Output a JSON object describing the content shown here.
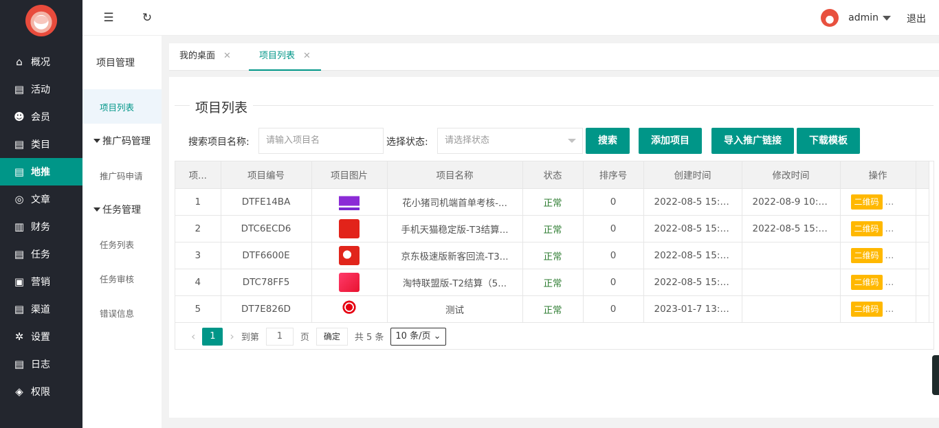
{
  "sidebar": {
    "items": [
      {
        "label": "概况",
        "icon": "home-icon"
      },
      {
        "label": "活动",
        "icon": "doc-icon"
      },
      {
        "label": "会员",
        "icon": "users-icon"
      },
      {
        "label": "类目",
        "icon": "doc-icon"
      },
      {
        "label": "地推",
        "icon": "doc-icon",
        "active": true
      },
      {
        "label": "文章",
        "icon": "compass-icon"
      },
      {
        "label": "财务",
        "icon": "chart-icon"
      },
      {
        "label": "任务",
        "icon": "doc-icon"
      },
      {
        "label": "营销",
        "icon": "gift-icon"
      },
      {
        "label": "渠道",
        "icon": "doc-icon"
      },
      {
        "label": "设置",
        "icon": "gear-icon"
      },
      {
        "label": "日志",
        "icon": "doc-icon"
      },
      {
        "label": "权限",
        "icon": "lock-icon"
      }
    ]
  },
  "subnav": {
    "head": "项目管理",
    "item_project_list": "项目列表",
    "group_promo": "推广码管理",
    "item_promo_apply": "推广码申请",
    "group_task": "任务管理",
    "item_task_list": "任务列表",
    "item_task_review": "任务审核",
    "item_errors": "错误信息"
  },
  "header": {
    "user": "admin",
    "logout": "退出"
  },
  "tabs": [
    {
      "label": "我的桌面"
    },
    {
      "label": "项目列表",
      "active": true
    }
  ],
  "page": {
    "title": "项目列表",
    "search_label": "搜索项目名称:",
    "search_placeholder": "请输入项目名",
    "status_label": "选择状态:",
    "status_placeholder": "请选择状态",
    "btn_search": "搜索",
    "btn_add": "添加项目",
    "btn_import": "导入推广链接",
    "btn_download": "下载模板"
  },
  "table": {
    "headers": [
      "项...",
      "项目编号",
      "项目图片",
      "项目名称",
      "状态",
      "排序号",
      "创建时间",
      "修改时间",
      "操作"
    ],
    "rows": [
      {
        "id": "1",
        "code": "DTFE14BA",
        "name": "花小猪司机端首单考核-...",
        "status": "正常",
        "sort": "0",
        "created": "2022-08-5 15:1...",
        "modified": "2022-08-9 10:5...",
        "op": "二维码",
        "more": "...",
        "img": "purple"
      },
      {
        "id": "2",
        "code": "DTC6ECD6",
        "name": "手机天猫稳定版-T3结算...",
        "status": "正常",
        "sort": "0",
        "created": "2022-08-5 15:1...",
        "modified": "2022-08-5 15:1...",
        "op": "二维码",
        "more": "...",
        "img": "tmall"
      },
      {
        "id": "3",
        "code": "DTF6600E",
        "name": "京东极速版新客回流-T3...",
        "status": "正常",
        "sort": "0",
        "created": "2022-08-5 15:1...",
        "modified": "",
        "op": "二维码",
        "more": "...",
        "img": "jd"
      },
      {
        "id": "4",
        "code": "DTC78FF5",
        "name": "淘特联盟版-T2结算（5...",
        "status": "正常",
        "sort": "0",
        "created": "2022-08-5 15:3...",
        "modified": "",
        "op": "二维码",
        "more": "...",
        "img": "taote"
      },
      {
        "id": "5",
        "code": "DT7E826D",
        "name": "测试",
        "status": "正常",
        "sort": "0",
        "created": "2023-01-7 13:1...",
        "modified": "",
        "op": "二维码",
        "more": "...",
        "img": "unicom"
      }
    ]
  },
  "pager": {
    "current": "1",
    "goto_label": "到第",
    "goto_value": "1",
    "page_unit": "页",
    "confirm": "确定",
    "total": "共 5 条",
    "page_size": "10 条/页"
  },
  "colors": {
    "accent": "#009688",
    "sidebar_bg": "#23262e",
    "badge": "#ffb800",
    "status_ok": "#2e7d32"
  }
}
